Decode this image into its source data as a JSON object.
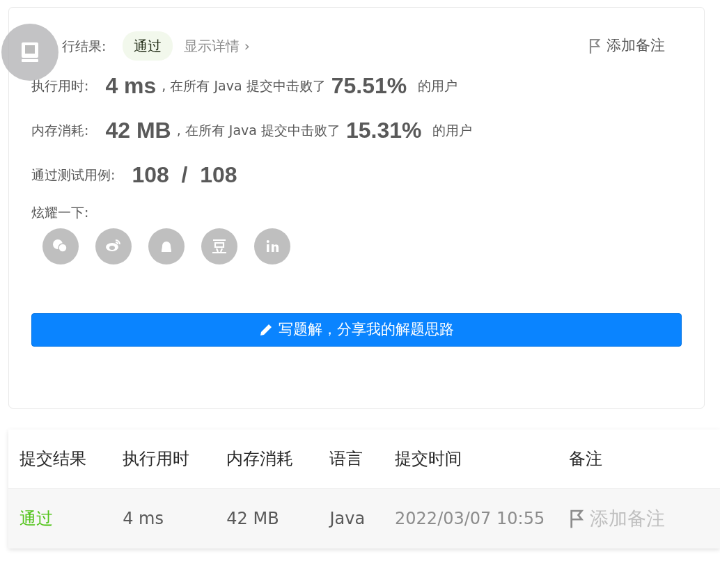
{
  "result": {
    "label": "行结果:",
    "status": "通过",
    "details_link": "显示详情 ›",
    "add_note": "添加备注"
  },
  "stats": [
    {
      "label": "执行用时:",
      "value": "4 ms",
      "text_before": ", 在所有 Java 提交中击败了",
      "percent": "75.51%",
      "text_after": "的用户"
    },
    {
      "label": "内存消耗:",
      "value": "42 MB",
      "text_before": ", 在所有 Java 提交中击败了",
      "percent": "15.31%",
      "text_after": "的用户"
    }
  ],
  "tests": {
    "label": "通过测试用例:",
    "value": "108  /  108"
  },
  "share": {
    "label": "炫耀一下:"
  },
  "write_button": "写题解，分享我的解题思路",
  "table": {
    "columns": [
      "提交结果",
      "执行用时",
      "内存消耗",
      "语言",
      "提交时间",
      "备注"
    ],
    "rows": [
      {
        "status": "通过",
        "runtime": "4 ms",
        "memory": "42 MB",
        "language": "Java",
        "time": "2022/03/07 10:55",
        "note": "添加备注"
      }
    ]
  }
}
